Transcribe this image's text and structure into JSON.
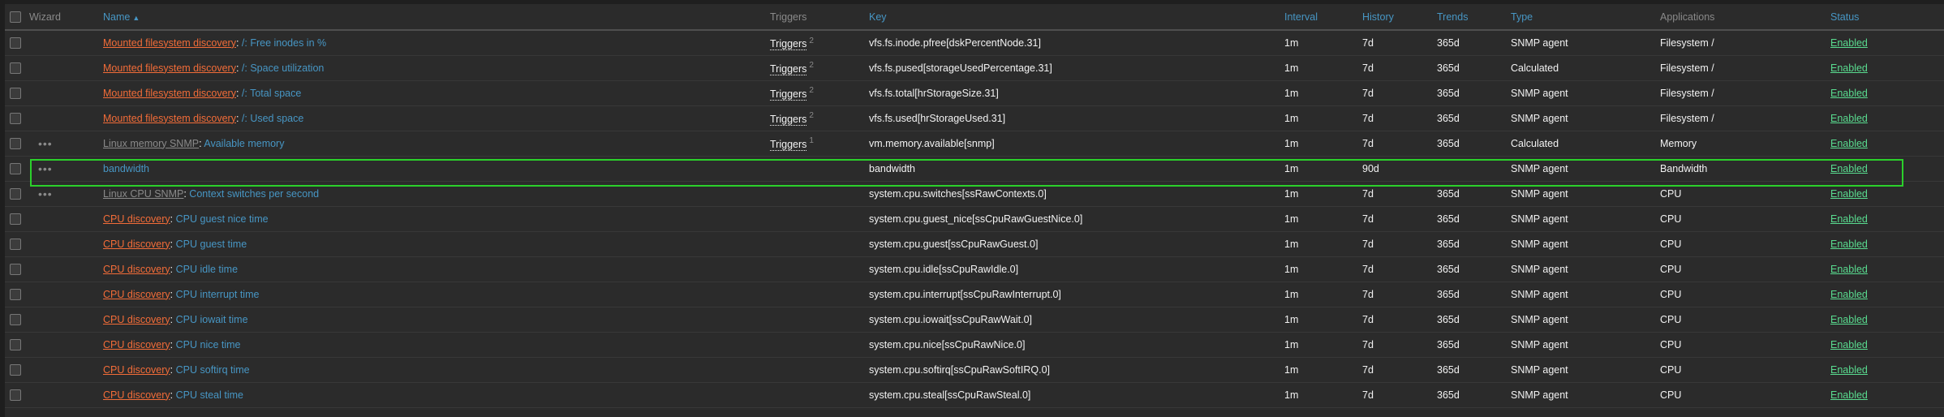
{
  "header": {
    "wizard": "Wizard",
    "name": "Name",
    "name_sort_icon": "sort-ascending-icon",
    "triggers": "Triggers",
    "key": "Key",
    "interval": "Interval",
    "history": "History",
    "trends": "Trends",
    "type": "Type",
    "applications": "Applications",
    "status": "Status"
  },
  "colors": {
    "accent": "#4796c4",
    "prefix": "#f26c38",
    "enabled": "#59db8f",
    "highlight": "#2bd02b"
  },
  "rows": [
    {
      "wizard": "",
      "prefix": "Mounted filesystem discovery",
      "prefix_style": "orange",
      "name": "/: Free inodes in %",
      "triggers": "Triggers",
      "trigger_count": "2",
      "key": "vfs.fs.inode.pfree[dskPercentNode.31]",
      "interval": "1m",
      "history": "7d",
      "trends": "365d",
      "type": "SNMP agent",
      "applications": "Filesystem /",
      "status": "Enabled"
    },
    {
      "wizard": "",
      "prefix": "Mounted filesystem discovery",
      "prefix_style": "orange",
      "name": "/: Space utilization",
      "triggers": "Triggers",
      "trigger_count": "2",
      "key": "vfs.fs.pused[storageUsedPercentage.31]",
      "interval": "1m",
      "history": "7d",
      "trends": "365d",
      "type": "Calculated",
      "applications": "Filesystem /",
      "status": "Enabled"
    },
    {
      "wizard": "",
      "prefix": "Mounted filesystem discovery",
      "prefix_style": "orange",
      "name": "/: Total space",
      "triggers": "Triggers",
      "trigger_count": "2",
      "key": "vfs.fs.total[hrStorageSize.31]",
      "interval": "1m",
      "history": "7d",
      "trends": "365d",
      "type": "SNMP agent",
      "applications": "Filesystem /",
      "status": "Enabled"
    },
    {
      "wizard": "",
      "prefix": "Mounted filesystem discovery",
      "prefix_style": "orange",
      "name": "/: Used space",
      "triggers": "Triggers",
      "trigger_count": "2",
      "key": "vfs.fs.used[hrStorageUsed.31]",
      "interval": "1m",
      "history": "7d",
      "trends": "365d",
      "type": "SNMP agent",
      "applications": "Filesystem /",
      "status": "Enabled"
    },
    {
      "wizard": "•••",
      "prefix": "Linux memory SNMP",
      "prefix_style": "gray",
      "name": "Available memory",
      "triggers": "Triggers",
      "trigger_count": "1",
      "key": "vm.memory.available[snmp]",
      "interval": "1m",
      "history": "7d",
      "trends": "365d",
      "type": "Calculated",
      "applications": "Memory",
      "status": "Enabled"
    },
    {
      "wizard": "•••",
      "prefix": "",
      "prefix_style": "",
      "name": "bandwidth",
      "triggers": "",
      "trigger_count": "",
      "key": "bandwidth",
      "interval": "1m",
      "history": "90d",
      "trends": "",
      "type": "SNMP agent",
      "applications": "Bandwidth",
      "status": "Enabled"
    },
    {
      "wizard": "•••",
      "prefix": "Linux CPU SNMP",
      "prefix_style": "gray",
      "name": "Context switches per second",
      "triggers": "",
      "trigger_count": "",
      "key": "system.cpu.switches[ssRawContexts.0]",
      "interval": "1m",
      "history": "7d",
      "trends": "365d",
      "type": "SNMP agent",
      "applications": "CPU",
      "status": "Enabled"
    },
    {
      "wizard": "",
      "prefix": "CPU discovery",
      "prefix_style": "orange",
      "name": "CPU guest nice time",
      "triggers": "",
      "trigger_count": "",
      "key": "system.cpu.guest_nice[ssCpuRawGuestNice.0]",
      "interval": "1m",
      "history": "7d",
      "trends": "365d",
      "type": "SNMP agent",
      "applications": "CPU",
      "status": "Enabled"
    },
    {
      "wizard": "",
      "prefix": "CPU discovery",
      "prefix_style": "orange",
      "name": "CPU guest time",
      "triggers": "",
      "trigger_count": "",
      "key": "system.cpu.guest[ssCpuRawGuest.0]",
      "interval": "1m",
      "history": "7d",
      "trends": "365d",
      "type": "SNMP agent",
      "applications": "CPU",
      "status": "Enabled"
    },
    {
      "wizard": "",
      "prefix": "CPU discovery",
      "prefix_style": "orange",
      "name": "CPU idle time",
      "triggers": "",
      "trigger_count": "",
      "key": "system.cpu.idle[ssCpuRawIdle.0]",
      "interval": "1m",
      "history": "7d",
      "trends": "365d",
      "type": "SNMP agent",
      "applications": "CPU",
      "status": "Enabled"
    },
    {
      "wizard": "",
      "prefix": "CPU discovery",
      "prefix_style": "orange",
      "name": "CPU interrupt time",
      "triggers": "",
      "trigger_count": "",
      "key": "system.cpu.interrupt[ssCpuRawInterrupt.0]",
      "interval": "1m",
      "history": "7d",
      "trends": "365d",
      "type": "SNMP agent",
      "applications": "CPU",
      "status": "Enabled"
    },
    {
      "wizard": "",
      "prefix": "CPU discovery",
      "prefix_style": "orange",
      "name": "CPU iowait time",
      "triggers": "",
      "trigger_count": "",
      "key": "system.cpu.iowait[ssCpuRawWait.0]",
      "interval": "1m",
      "history": "7d",
      "trends": "365d",
      "type": "SNMP agent",
      "applications": "CPU",
      "status": "Enabled"
    },
    {
      "wizard": "",
      "prefix": "CPU discovery",
      "prefix_style": "orange",
      "name": "CPU nice time",
      "triggers": "",
      "trigger_count": "",
      "key": "system.cpu.nice[ssCpuRawNice.0]",
      "interval": "1m",
      "history": "7d",
      "trends": "365d",
      "type": "SNMP agent",
      "applications": "CPU",
      "status": "Enabled"
    },
    {
      "wizard": "",
      "prefix": "CPU discovery",
      "prefix_style": "orange",
      "name": "CPU softirq time",
      "triggers": "",
      "trigger_count": "",
      "key": "system.cpu.softirq[ssCpuRawSoftIRQ.0]",
      "interval": "1m",
      "history": "7d",
      "trends": "365d",
      "type": "SNMP agent",
      "applications": "CPU",
      "status": "Enabled"
    },
    {
      "wizard": "",
      "prefix": "CPU discovery",
      "prefix_style": "orange",
      "name": "CPU steal time",
      "triggers": "",
      "trigger_count": "",
      "key": "system.cpu.steal[ssCpuRawSteal.0]",
      "interval": "1m",
      "history": "7d",
      "trends": "365d",
      "type": "SNMP agent",
      "applications": "CPU",
      "status": "Enabled"
    }
  ]
}
